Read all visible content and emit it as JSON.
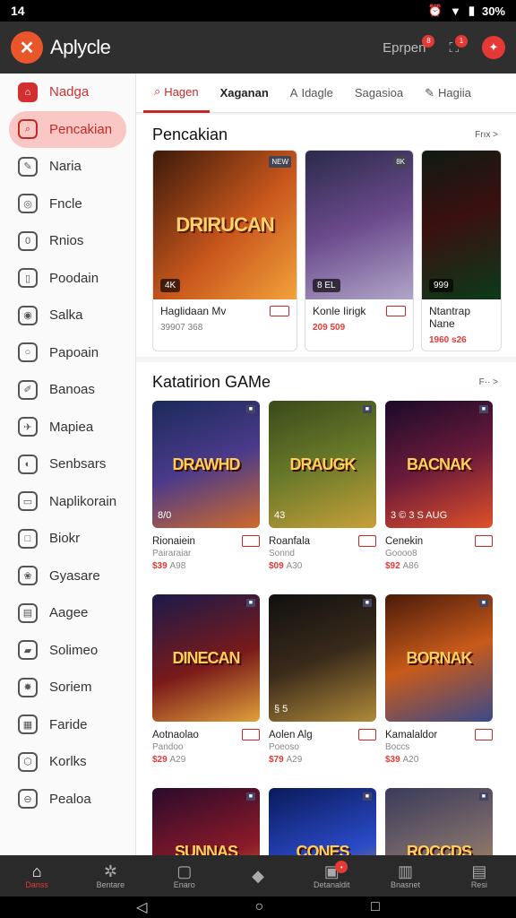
{
  "status": {
    "time": "14",
    "battery": "30%"
  },
  "app": {
    "title": "Aplycle",
    "search_label": "Eprpen",
    "search_badge": "8",
    "cart_badge": "1"
  },
  "sidebar": {
    "items": [
      {
        "label": "Nadga",
        "icon": "home-icon"
      },
      {
        "label": "Pencakian",
        "icon": "search-icon"
      },
      {
        "label": "Naria",
        "icon": "tag-icon"
      },
      {
        "label": "Fncle",
        "icon": "circle-icon"
      },
      {
        "label": "Rnios",
        "icon": "zero-icon"
      },
      {
        "label": "Poodain",
        "icon": "book-icon"
      },
      {
        "label": "Salka",
        "icon": "eye-icon"
      },
      {
        "label": "Papoain",
        "icon": "ring-icon"
      },
      {
        "label": "Banoas",
        "icon": "pen-icon"
      },
      {
        "label": "Mapiea",
        "icon": "plane-icon"
      },
      {
        "label": "Senbsars",
        "icon": "compass-icon"
      },
      {
        "label": "Naplikorain",
        "icon": "file-icon"
      },
      {
        "label": "Biokr",
        "icon": "square-icon"
      },
      {
        "label": "Gyasare",
        "icon": "chat-icon"
      },
      {
        "label": "Aagee",
        "icon": "doc-icon"
      },
      {
        "label": "Solimeo",
        "icon": "ticket-icon"
      },
      {
        "label": "Soriem",
        "icon": "burst-icon"
      },
      {
        "label": "Faride",
        "icon": "calendar-icon"
      },
      {
        "label": "Korlks",
        "icon": "hex-icon"
      },
      {
        "label": "Pealoa",
        "icon": "minus-circle-icon"
      }
    ]
  },
  "tabs": [
    {
      "label": "Hagen",
      "icon": "search-icon"
    },
    {
      "label": "Xaganan",
      "icon": ""
    },
    {
      "label": "Idagle",
      "icon": "a-icon"
    },
    {
      "label": "Sagasioa",
      "icon": ""
    },
    {
      "label": "Hagiia",
      "icon": "tag-icon"
    }
  ],
  "featured": {
    "title": "Pencakian",
    "more": "Frıx >",
    "cards": [
      {
        "art": "DRIRUCAN",
        "tag": "4K",
        "corner": "NEW",
        "name": "Haglidaan Mv",
        "price": "39907 368"
      },
      {
        "art": "",
        "tag": "8 EL",
        "corner": "8K",
        "name": "Konle Iirigk",
        "price": "209 509"
      },
      {
        "art": "",
        "tag": "999",
        "corner": "",
        "name": "Ntantrap Nane",
        "price": "1960 s26"
      }
    ]
  },
  "catalog": {
    "title": "Katatirion GAMe",
    "more": "F·· >",
    "games": [
      {
        "art": "DRAWHD",
        "tag": "8/0",
        "name": "Rionaiein",
        "sub": "Pairaraiar",
        "price": "$39",
        "price_sub": "A98"
      },
      {
        "art": "DRAUGK",
        "tag": "43",
        "name": "Roanfala",
        "sub": "Sonnd",
        "price": "$09",
        "price_sub": "A30"
      },
      {
        "art": "BACNAK",
        "tag": "3 © 3 S AUG",
        "name": "Cenekin",
        "sub": "Goooo8",
        "price": "$92",
        "price_sub": "A86"
      },
      {
        "art": "DINECAN",
        "tag": "",
        "name": "Aotnaolao",
        "sub": "Pandoo",
        "price": "$29",
        "price_sub": "A29"
      },
      {
        "art": "",
        "tag": "§ 5",
        "name": "Aolen Alg",
        "sub": "Poeoso",
        "price": "$79",
        "price_sub": "A29"
      },
      {
        "art": "BORNAK",
        "tag": "",
        "name": "Kamalaldor",
        "sub": "Boccs",
        "price": "$39",
        "price_sub": "A20"
      },
      {
        "art": "SUNNAS",
        "tag": "",
        "name": "",
        "sub": "",
        "price": "",
        "price_sub": ""
      },
      {
        "art": "CONES",
        "tag": "",
        "name": "",
        "sub": "",
        "price": "",
        "price_sub": ""
      },
      {
        "art": "ROCCDS",
        "tag": "",
        "name": "",
        "sub": "",
        "price": "",
        "price_sub": ""
      }
    ]
  },
  "bottomnav": [
    {
      "label": "Danss",
      "icon": "home-icon"
    },
    {
      "label": "Bentare",
      "icon": "gear-icon"
    },
    {
      "label": "Enaro",
      "icon": "box-icon"
    },
    {
      "label": "",
      "icon": "diamond-icon"
    },
    {
      "label": "Detanaldit",
      "icon": "frame-icon"
    },
    {
      "label": "Bnasnet",
      "icon": "bag-icon"
    },
    {
      "label": "Resi",
      "icon": "tray-icon"
    }
  ],
  "colors": {
    "accent": "#d32f2f",
    "appbar": "#2f2f2f",
    "active_pill": "#f9c7c4"
  }
}
